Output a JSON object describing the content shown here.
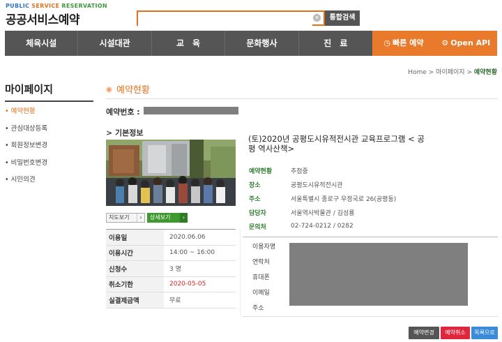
{
  "header": {
    "logo_top_1": "PUBLIC",
    "logo_top_2": "SERVICE",
    "logo_top_3": "RESERVATION",
    "logo_main": "공공서비스예약",
    "search_placeholder": "",
    "search_button": "통합검색"
  },
  "nav": {
    "items": [
      "체육시설",
      "시설대관",
      "교　육",
      "문화행사",
      "진　료"
    ],
    "quick_reserve": "빠른 예약",
    "open_api": "Open API"
  },
  "breadcrumb": {
    "home": "Home",
    "sep": ">",
    "mypage": "마이페이지",
    "current": "예약현황"
  },
  "sidebar": {
    "title": "마이페이지",
    "items": [
      "예약현황",
      "관심대상등록",
      "회원정보변경",
      "비밀번호변경",
      "시민의견"
    ]
  },
  "main": {
    "title": "예약현황",
    "reservation_no_label": "예약번호 :",
    "basic_info_label": "> 기본정보",
    "map_button": "지도보기",
    "detail_button": "상세보기",
    "info": [
      {
        "k": "이용일",
        "v": "2020.06.06"
      },
      {
        "k": "이용시간",
        "v": "14:00 ~ 16:00"
      },
      {
        "k": "신청수",
        "v": "3 명"
      },
      {
        "k": "취소기한",
        "v": "2020-05-05"
      },
      {
        "k": "실결제금액",
        "v": "무료"
      }
    ],
    "program_title": "(토)2020년 공평도시유적전시관 교육프로그램 < 공평 역사산책>",
    "program_info": [
      {
        "k": "예약현황",
        "v": "추첨중"
      },
      {
        "k": "장소",
        "v": "공평도시유적전시관"
      },
      {
        "k": "주소",
        "v": "서울특별시 종로구 우정국로 26(공평동)"
      },
      {
        "k": "담당자",
        "v": "서울역사박물관 / 김성룡"
      },
      {
        "k": "문의처",
        "v": "02-724-0212 / 0282"
      }
    ],
    "user_labels": [
      "이용자명",
      "연락처",
      "휴대폰",
      "이메일",
      "주소"
    ]
  },
  "buttons": {
    "change": "예약변경",
    "cancel": "예약취소",
    "list": "목록으로"
  },
  "colors": {
    "accent": "#e2701a",
    "nav_bg": "#555555",
    "green": "#3e9a2e",
    "cancel": "#e0263d",
    "list": "#3b8bd9"
  }
}
